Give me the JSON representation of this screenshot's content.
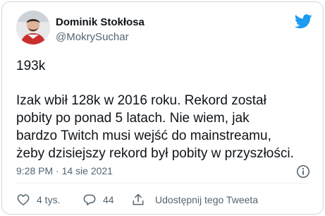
{
  "tweet": {
    "author_name": "Dominik Stokłosa",
    "author_handle": "@MokrySuchar",
    "text_line1": "193k",
    "text_body": [
      "Izak wbił 128k w 2016 roku. Rekord został",
      "pobity po ponad 5 latach. Nie wiem, jak",
      "bardzo Twitch musi wejść do mainstreamu,",
      "żeby dzisiejszy rekord był pobity w przyszłości."
    ],
    "timestamp": "9:28 PM · 14 sie 2021"
  },
  "actions": {
    "likes": "4 tys.",
    "replies": "44",
    "share_label": "Udostępnij tego Tweeta"
  },
  "colors": {
    "brand_blue": "#1d9bf0",
    "text_primary": "#0f1419",
    "text_secondary": "#536471",
    "border": "#cfd9de"
  },
  "icons": [
    "twitter-bird-icon",
    "info-icon",
    "heart-icon",
    "reply-icon",
    "share-icon"
  ]
}
